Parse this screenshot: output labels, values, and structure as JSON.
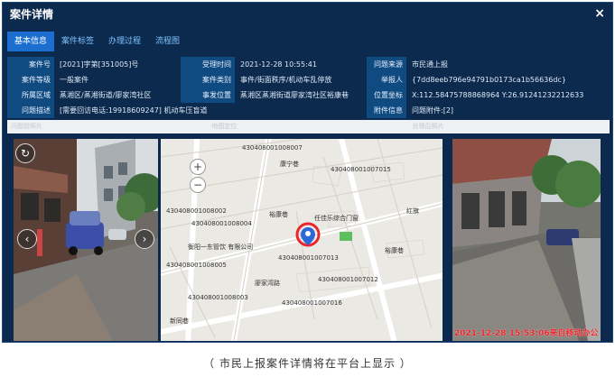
{
  "window": {
    "title": "案件详情",
    "close_glyph": "×"
  },
  "tabs": [
    "基本信息",
    "案件标签",
    "办理过程",
    "流程图"
  ],
  "info": {
    "case_no_label": "案件号",
    "case_no": "[2021]字第[351005]号",
    "accept_time_label": "受理时间",
    "accept_time": "2021-12-28 10:55:41",
    "source_label": "问题来源",
    "source": "市民通上报",
    "level_label": "案件等级",
    "level": "一般案件",
    "category_label": "案件类别",
    "category": "事件/街面秩序/机动车乱停放",
    "reporter_label": "举报人",
    "reporter": "{7dd8eeb796e94791b0173ca1b56636dc}",
    "area_label": "所属区域",
    "area": "蒸湘区/蒸湘街道/廖家湾社区",
    "place_label": "事发位置",
    "place": "蒸湘区蒸湘街道廖家湾社区裕康巷",
    "coord_label": "位置坐标",
    "coord": "X:112.58475788868964 Y:26.91241232212633",
    "desc_label": "问题描述",
    "desc": "[需要回访电话:19918609247] 机动车压盲道",
    "attach_label": "附件信息",
    "attach": "问题附件:[2]"
  },
  "sections": [
    "问题前照片",
    "地图定位",
    "处理后照片"
  ],
  "map": {
    "labels": [
      {
        "t": "430408001008007"
      },
      {
        "t": "康宁巷"
      },
      {
        "t": "430408001007015"
      },
      {
        "t": "430408001008002"
      },
      {
        "t": "430408001008004"
      },
      {
        "t": "裕康巷"
      },
      {
        "t": "任佳乐综合门窗"
      },
      {
        "t": "红旗"
      },
      {
        "t": "衡阳一东管饮 有限公司"
      },
      {
        "t": "430408001007013"
      },
      {
        "t": "裕康巷"
      },
      {
        "t": "430408001008005"
      },
      {
        "t": "廖家湾路"
      },
      {
        "t": "430408001007012"
      },
      {
        "t": "430408001008003"
      },
      {
        "t": "430408001007016"
      },
      {
        "t": "新同巷"
      }
    ],
    "zoom_in": "+",
    "zoom_out": "−"
  },
  "photo_timestamp": "2021-12-28 15:53:06来自移动办公",
  "caption": "（ 市民上报案件详情将在平台上显示 ）",
  "colors": {
    "bg": "#0b2a4e",
    "tab_active": "#1c6fd1",
    "label_bg": "#0f4a80",
    "marker": "#e8262b"
  }
}
